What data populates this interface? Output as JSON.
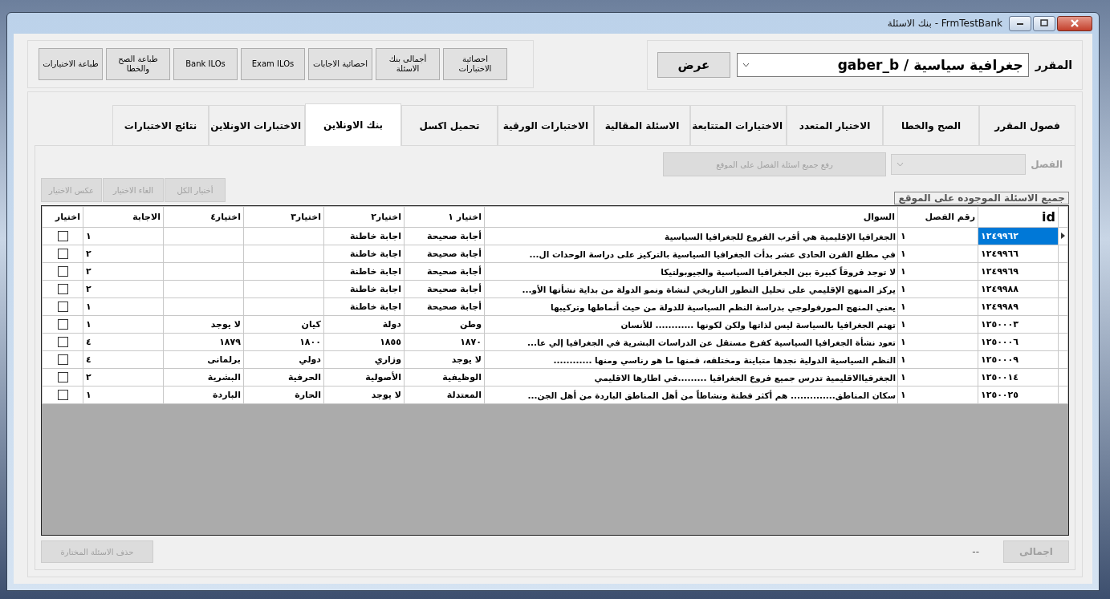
{
  "window": {
    "title": "بنك الاسئلة - FrmTestBank"
  },
  "toolbar": [
    {
      "label": "احصائية الاختبارات"
    },
    {
      "label": "أجمالى بنك الاسئلة"
    },
    {
      "label": "احصائية الاجابات"
    },
    {
      "label": "Exam ILOs"
    },
    {
      "label": "Bank ILOs"
    },
    {
      "label": "طباعة الصح والخطا"
    },
    {
      "label": "طباعة الاختيارات"
    }
  ],
  "course": {
    "label": "المقرر",
    "value": "جغرافية سياسية / gaber_b",
    "button": "عرض"
  },
  "tabs": [
    {
      "label": "فصول المقرر",
      "selected": false
    },
    {
      "label": "الصح والخطا",
      "selected": false
    },
    {
      "label": "الاختيار المتعدد",
      "selected": false
    },
    {
      "label": "الاختيارات المتتابعة",
      "selected": false
    },
    {
      "label": "الاسئلة المقالية",
      "selected": false
    },
    {
      "label": "الاختبارات الورقية",
      "selected": false
    },
    {
      "label": "تحميل اكسل",
      "selected": false
    },
    {
      "label": "بنك الاونلاين",
      "selected": true
    },
    {
      "label": "الاختبارات الاونلاين",
      "selected": false
    },
    {
      "label": "نتائج الاختبارات",
      "selected": false
    }
  ],
  "filter": {
    "label": "الفصل",
    "disabled": true,
    "upload_button": {
      "label": "رفع جميع اسئلة الفصل على الموقع",
      "disabled": true
    },
    "select_buttons": [
      {
        "label": "أختيار الكل",
        "disabled": true
      },
      {
        "label": "الغاء الاختيار",
        "disabled": true
      },
      {
        "label": "عكس الاختيار",
        "disabled": true
      }
    ],
    "all_online_label": "جميع الاسئلة الموجوده على الموقع"
  },
  "table": {
    "columns": [
      "id",
      "رقم الفصل",
      "السوال",
      "اختيار ١",
      "اختيار٢",
      "اختيار٣",
      "اختيار٤",
      "الاجابة",
      "اختيار"
    ],
    "rows": [
      {
        "id": "١٢٤٩٩٦٢",
        "chapter": "١",
        "question": "الجغرافيا الإقليمية هي أقرب الفروع للجغرافيا السياسية",
        "choices": [
          "أجابة صحيحة",
          "اجابة خاطنة"
        ],
        "answer": "١",
        "checked": false,
        "selected": true
      },
      {
        "id": "١٢٤٩٩٦٦",
        "chapter": "١",
        "question": "في مطلع القرن الحادى عشر  بدأت الجغرافيا السياسية بالتركيز على دراسة الوحدات ال...",
        "choices": [
          "أجابة صحيحة",
          "اجابة خاطنة"
        ],
        "answer": "٢",
        "checked": false,
        "selected": false
      },
      {
        "id": "١٢٤٩٩٦٩",
        "chapter": "١",
        "question": "لا توجد  فروقاً كبيرة بين الجغرافيا السياسية والجيوبولتيكا",
        "choices": [
          "أجابة صحيحة",
          "اجابة خاطنة"
        ],
        "answer": "٢",
        "checked": false,
        "selected": false
      },
      {
        "id": "١٢٤٩٩٨٨",
        "chapter": "١",
        "question": "يركز المنهج الإقليمي على تحليل التطور التاريخي لنشاة ونمو الدولة من بداية نشأتها الأو...",
        "choices": [
          "أجابة صحيحة",
          "اجابة خاطنة"
        ],
        "answer": "٢",
        "checked": false,
        "selected": false
      },
      {
        "id": "١٢٤٩٩٨٩",
        "chapter": "١",
        "question": "يعني المنهج المورفولوجي بدراسة النظم السياسية للدولة من حيث أنماطها وتركيبها",
        "choices": [
          "أجابة صحيحة",
          "اجابة خاطنة"
        ],
        "answer": "١",
        "checked": false,
        "selected": false
      },
      {
        "id": "١٢٥٠٠٠٣",
        "chapter": "١",
        "question": "تهتم الجغرافيا بالسياسة ليس لذاتها ولكن لكونها ............ للأنسان",
        "choices": [
          "وطن",
          "دولة",
          "كيان",
          "لا يوجد"
        ],
        "answer": "١",
        "checked": false,
        "selected": false
      },
      {
        "id": "١٢٥٠٠٠٦",
        "chapter": "١",
        "question": "تعود نشأة الجغرافيا السياسية   كفرع مستقل عن الدراسات البشرية في الجغرافيا إلي عا...",
        "choices": [
          "١٨٧٠",
          "١٨٥٥",
          "١٨٠٠",
          "١٨٧٩"
        ],
        "answer": "٤",
        "checked": false,
        "selected": false
      },
      {
        "id": "١٢٥٠٠٠٩",
        "chapter": "١",
        "question": "النظم السياسية الدولية نجدها متباينة ومختلفه، فمنها ما هو رناسي ومنها ............",
        "choices": [
          "لا يوجد",
          "وزاري",
          "دولي",
          "برلمانى"
        ],
        "answer": "٤",
        "checked": false,
        "selected": false
      },
      {
        "id": "١٢٥٠٠١٤",
        "chapter": "١",
        "question": "الجغرفياالاقليمية تدرس جميع فروع الجغرافيا .........في اطارها الاقليمي",
        "choices": [
          "الوظيفية",
          "الأصولية",
          "الحرفية",
          "البشرية"
        ],
        "answer": "٢",
        "checked": false,
        "selected": false
      },
      {
        "id": "١٢٥٠٠٢٥",
        "chapter": "١",
        "question": "سكان المناطق.............. هم أكثر فطنة ونشاطاً من أهل المناطق الباردة من أهل الجن...",
        "choices": [
          "المعتدلة",
          "لا يوجد",
          "الحارة",
          "الباردة"
        ],
        "answer": "١",
        "checked": false,
        "selected": false
      }
    ]
  },
  "footer": {
    "delete_button": {
      "label": "حذف الاسئلة المختارة",
      "disabled": true
    },
    "total_value": "--",
    "total_button": {
      "label": "اجمالى",
      "disabled": true
    }
  }
}
